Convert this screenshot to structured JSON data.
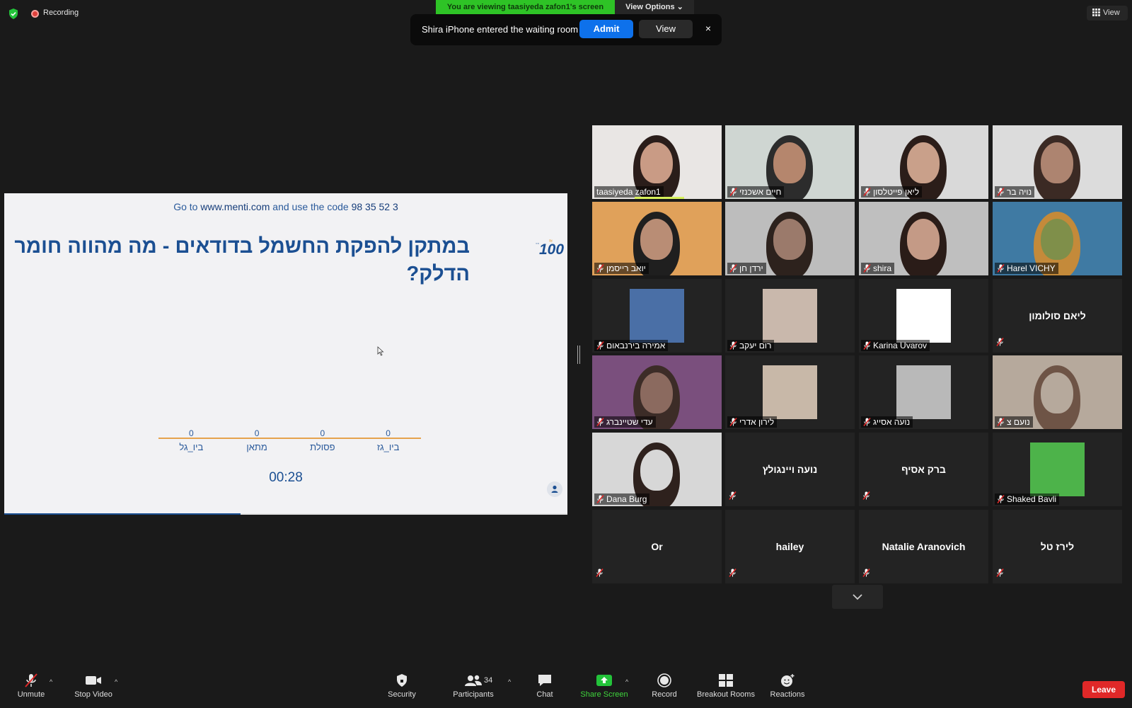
{
  "topbar": {
    "recording_label": "Recording",
    "viewing_banner": "You are viewing taasiyeda zafon1's screen",
    "view_options_label": "View Options",
    "view_label": "View"
  },
  "waiting_toast": {
    "message": "Shira iPhone  entered the waiting room",
    "admit_label": "Admit",
    "view_label": "View",
    "close_glyph": "×"
  },
  "shared_screen": {
    "code_prefix": "Go to",
    "url": "www.menti.com",
    "code_mid": "and use the code",
    "code": "98 35 52 3",
    "question": "במתקן להפקת החשמל בדודאים - מה מהווה חומר הדלק?",
    "logo_number": "100",
    "timer": "00:28",
    "progress_fraction": 0.42
  },
  "chart_data": {
    "type": "bar",
    "categories": [
      "ביו_גל",
      "מתאן",
      "פסולת",
      "ביו_גז"
    ],
    "values": [
      0,
      0,
      0,
      0
    ]
  },
  "gallery": {
    "tiles": [
      {
        "name": "taasiyeda zafon1",
        "video": true,
        "muted": false,
        "bg": "#e9e6e4",
        "skin": "#c99b85",
        "hair": "#2a1d1a",
        "speaking_bar": true
      },
      {
        "name": "חיים אשכנזי",
        "video": true,
        "muted": true,
        "bg": "#cfd6d2",
        "skin": "#b5866d",
        "hair": "#2c2c2c",
        "speaking": true
      },
      {
        "name": "ליאן פייטלסון",
        "video": true,
        "muted": true,
        "bg": "#d9d9d9",
        "skin": "#c9a08a",
        "hair": "#2b1d19"
      },
      {
        "name": "נויה בר",
        "video": true,
        "muted": true,
        "bg": "#dcdcdc",
        "skin": "#ad8470",
        "hair": "#3b2a24"
      },
      {
        "name": "יואב רייסמן",
        "video": true,
        "muted": true,
        "bg": "#e0a15a",
        "skin": "#b98d75",
        "hair": "#1f1f1f"
      },
      {
        "name": "ירדן חן",
        "video": true,
        "muted": true,
        "bg": "#bdbdbd",
        "skin": "#9b7a6b",
        "hair": "#2d221d"
      },
      {
        "name": "shira",
        "video": true,
        "muted": true,
        "bg": "#bfbfbf",
        "skin": "#c49a86",
        "hair": "#2a1c18"
      },
      {
        "name": "Harel VICHY",
        "video": true,
        "muted": true,
        "bg": "#3f7aa3",
        "skin": "#7f8f4a",
        "hair": "#c48a3a"
      },
      {
        "name": "אמירה בירנבאום",
        "video": true,
        "muted": true,
        "bg": "#232323",
        "photo": "#4a6fa6"
      },
      {
        "name": "רום יעקב",
        "video": true,
        "muted": true,
        "bg": "#232323",
        "photo": "#c9b8ac"
      },
      {
        "name": "Karina Uvarov",
        "video": true,
        "muted": true,
        "bg": "#232323",
        "photo": "#ffffff"
      },
      {
        "name": "ליאם סולומון",
        "video": false,
        "muted": true
      },
      {
        "name": "עדי שטיינברג",
        "video": true,
        "muted": true,
        "bg": "#7a4f7d",
        "skin": "#8b6a5f",
        "hair": "#3c2c27"
      },
      {
        "name": "לירון אדרי",
        "video": true,
        "muted": true,
        "bg": "#232323",
        "photo": "#c8b8a8"
      },
      {
        "name": "נועה אסייג",
        "video": true,
        "muted": true,
        "bg": "#232323",
        "photo": "#b9b9b9"
      },
      {
        "name": "נועם צ",
        "video": true,
        "muted": true,
        "bg": "#b6a99c",
        "skin": "#b6a99c",
        "hair": "#6e5446"
      },
      {
        "name": "Dana Burg",
        "video": true,
        "muted": true,
        "bg": "#d7d7d7",
        "skin": "#d7d7d7",
        "hair": "#2e211d"
      },
      {
        "name": "נועה ויינגולץ",
        "video": false,
        "muted": true
      },
      {
        "name": "ברק אסיף",
        "video": false,
        "muted": true
      },
      {
        "name": "Shaked Bavli",
        "video": true,
        "muted": true,
        "bg": "#232323",
        "photo": "#4db34a"
      },
      {
        "name": "Or",
        "video": false,
        "muted": true
      },
      {
        "name": "hailey",
        "video": false,
        "muted": true
      },
      {
        "name": "Natalie Aranovich",
        "video": false,
        "muted": true
      },
      {
        "name": "לירז טל",
        "video": false,
        "muted": true
      }
    ]
  },
  "toolbar": {
    "unmute": "Unmute",
    "stop_video": "Stop Video",
    "security": "Security",
    "participants": "Participants",
    "participants_count": "34",
    "chat": "Chat",
    "share_screen": "Share Screen",
    "record": "Record",
    "breakout_rooms": "Breakout Rooms",
    "reactions": "Reactions",
    "leave": "Leave"
  },
  "colors": {
    "banner_green": "#2ec326",
    "admit_blue": "#0e71eb",
    "leave_red": "#e02828",
    "speaking_outline": "#d6f05b",
    "menti_blue": "#1b4f92",
    "chart_axis": "#e6a34d"
  }
}
